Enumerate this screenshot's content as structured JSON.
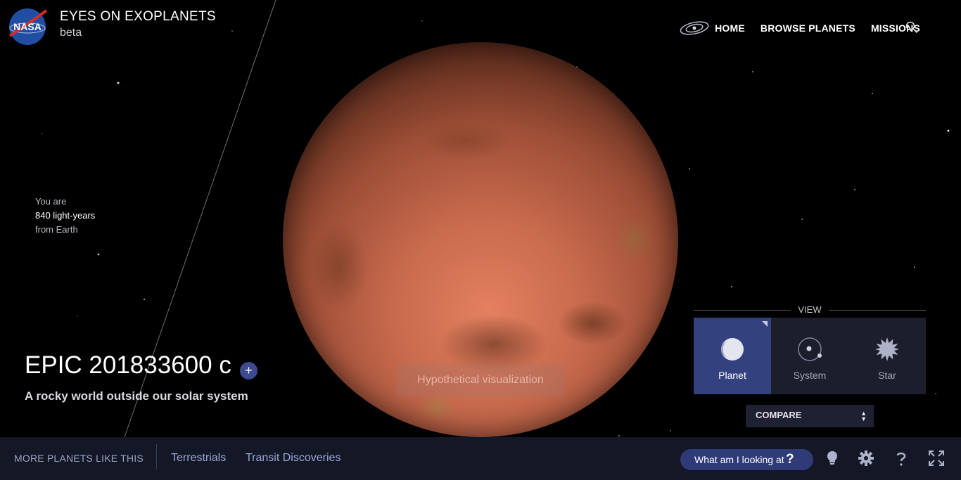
{
  "header": {
    "logo_text": "NASA",
    "title": "EYES ON EXOPLANETS",
    "subtitle": "beta",
    "nav": [
      "HOME",
      "BROWSE PLANETS",
      "MISSIONS"
    ],
    "galaxy_icon": "galaxy-icon",
    "search_icon": "search-icon"
  },
  "distance": {
    "prefix": "You are",
    "value": "840 light-years",
    "suffix": "from Earth"
  },
  "planet": {
    "name": "EPIC 201833600 c",
    "plus_label": "+",
    "tagline": "A rocky world outside our solar system",
    "visual_note": "Hypothetical visualization"
  },
  "view": {
    "label": "VIEW",
    "options": [
      {
        "label": "Planet",
        "icon": "planet-icon",
        "active": true
      },
      {
        "label": "System",
        "icon": "system-icon",
        "active": false
      },
      {
        "label": "Star",
        "icon": "star-icon",
        "active": false
      }
    ],
    "compare_label": "COMPARE"
  },
  "bottom": {
    "more_label": "MORE PLANETS LIKE THIS",
    "categories": [
      "Terrestrials",
      "Transit Discoveries"
    ],
    "looking_label": "What am I looking at",
    "looking_q": "?",
    "tools": [
      "lightbulb-icon",
      "gear-icon",
      "help-icon",
      "fullscreen-icon"
    ]
  },
  "colors": {
    "accent": "#34417f",
    "bar": "#141726",
    "planet": "#c86a4d"
  }
}
